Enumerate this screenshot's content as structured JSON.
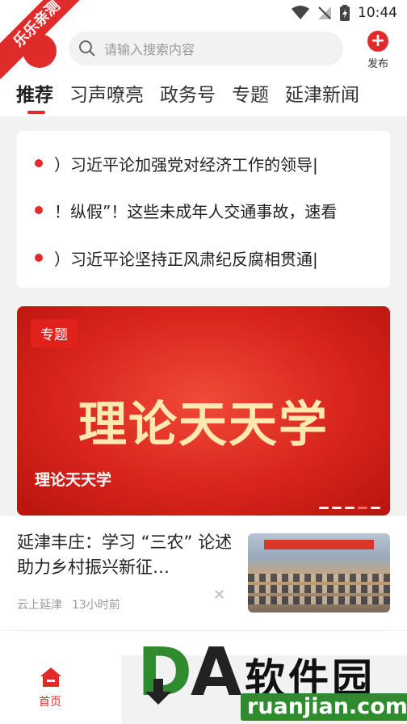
{
  "status_bar": {
    "time": "10:44"
  },
  "ribbon": {
    "label": "乐乐亲测"
  },
  "header": {
    "search_placeholder": "请输入搜索内容",
    "publish_label": "发布"
  },
  "tabs": [
    {
      "label": "推荐"
    },
    {
      "label": "习声嘹亮"
    },
    {
      "label": "政务号"
    },
    {
      "label": "专题"
    },
    {
      "label": "延津新闻"
    }
  ],
  "headlines": [
    {
      "text": "|习近平论加强党对经济工作的领导（"
    },
    {
      "text": "纵假”！这些未成年人交通事故，速看！"
    },
    {
      "text": "|习近平论坚持正风肃纪反腐相贯通（"
    }
  ],
  "banner": {
    "tag": "专题",
    "big_text": "理论天天学",
    "caption": "理论天天学",
    "slide_count": 5,
    "active_slide": 4
  },
  "news": [
    {
      "title": "延津丰庄：学习 “三农” 论述 助力乡村振兴新征…",
      "source": "云上延津",
      "time": "13小时前"
    }
  ],
  "bottom_nav": {
    "home_label": "首页"
  },
  "watermark": {
    "brand_left": "D",
    "brand_right": "A",
    "name": "软件园",
    "url": "ruanjian.com"
  },
  "colors": {
    "accent": "#e02b2b",
    "watermark_green": "#2e8b2e"
  }
}
